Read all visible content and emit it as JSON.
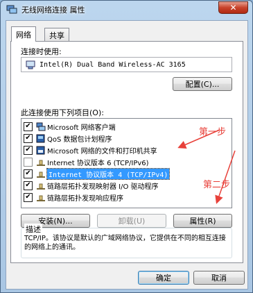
{
  "window": {
    "title": "无线网络连接 属性",
    "close_label": "✕"
  },
  "tabs": [
    {
      "label": "网络"
    },
    {
      "label": "共享"
    }
  ],
  "connect_using_label": "连接时使用:",
  "adapter_name": "Intel(R) Dual Band Wireless-AC 3165",
  "configure_button": "配置(C)...",
  "items_label": "此连接使用下列项目(O):",
  "items": [
    {
      "label": "Microsoft 网络客户端",
      "checked": true,
      "icon": "network-client-icon"
    },
    {
      "label": "QoS 数据包计划程序",
      "checked": true,
      "icon": "qos-icon"
    },
    {
      "label": "Microsoft 网络的文件和打印机共享",
      "checked": true,
      "icon": "file-printer-sharing-icon"
    },
    {
      "label": "Internet 协议版本 6 (TCP/IPv6)",
      "checked": false,
      "icon": "protocol-icon"
    },
    {
      "label": "Internet 协议版本 4 (TCP/IPv4)",
      "checked": true,
      "icon": "protocol-icon",
      "selected": true
    },
    {
      "label": "链路层拓扑发现映射器 I/O 驱动程序",
      "checked": true,
      "icon": "protocol-icon"
    },
    {
      "label": "链路层拓扑发现响应程序",
      "checked": true,
      "icon": "protocol-icon"
    }
  ],
  "install_button": "安装(N)...",
  "uninstall_button": "卸载(U)",
  "properties_button": "属性(R)",
  "description": {
    "legend": "描述",
    "text": "TCP/IP。该协议是默认的广域网络协议，它提供在不同的相互连接的网络上的通讯。"
  },
  "ok_button": "确定",
  "cancel_button": "取消",
  "annotations": {
    "step1": "第一步",
    "step2": "第二步"
  },
  "colors": {
    "annotation": "#e8413a",
    "selection": "#3399ff",
    "title_bar": "#bcd6ee"
  }
}
